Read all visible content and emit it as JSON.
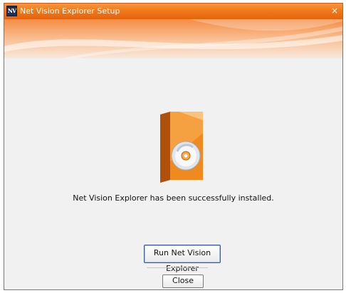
{
  "window": {
    "title": "Net Vision Explorer Setup",
    "app_icon_text": "NV",
    "close_glyph": "×"
  },
  "main": {
    "message": "Net Vision Explorer has been successfully installed.",
    "run_button_label": "Run Net Vision Explorer",
    "close_button_label": "Close"
  },
  "icons": {
    "app": "app-logo-icon",
    "product": "software-box-with-cd-icon"
  },
  "colors": {
    "titlebar": "#ef7417",
    "banner": "#f48d45",
    "background": "#f1f1f1",
    "box_orange": "#f08a1e"
  }
}
